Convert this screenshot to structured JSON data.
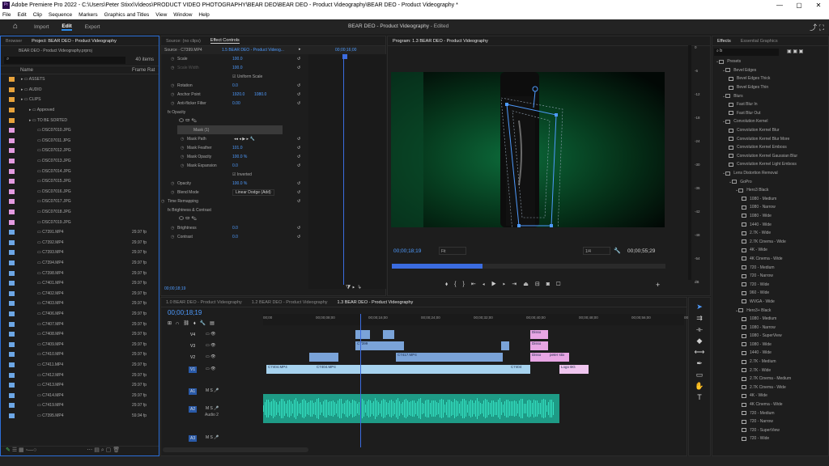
{
  "window": {
    "app_icon": "Pr",
    "title": "Adobe Premiere Pro 2022 - C:\\Users\\Peter Stixx\\Videos\\PRODUCT VIDEO PHOTOGRAPHY\\BEAR DEO\\BEAR DEO - Product Videography\\BEAR DEO - Product Videography *",
    "minimize": "—",
    "maximize": "▢",
    "close": "✕"
  },
  "menu": [
    "File",
    "Edit",
    "Clip",
    "Sequence",
    "Markers",
    "Graphics and Titles",
    "View",
    "Window",
    "Help"
  ],
  "workspaces": {
    "items": [
      "Import",
      "Edit",
      "Export"
    ],
    "active": "Edit"
  },
  "doc_title": {
    "name": "BEAR DEO - Product Videography",
    "status": "Edited",
    "sep": " - "
  },
  "project": {
    "tabs": [
      "Browser",
      "Project: BEAR DEO - Product Videography"
    ],
    "file": "BEAR DEO - Product Videography.prproj",
    "count": "40 items",
    "col_name": "Name",
    "col_rate": "Frame Rat",
    "items": [
      {
        "name": "ASSETS",
        "color": "or",
        "indent": 0,
        "rate": ""
      },
      {
        "name": "AUDIO",
        "color": "or",
        "indent": 0,
        "rate": ""
      },
      {
        "name": "CLIPS",
        "color": "or",
        "indent": 0,
        "rate": ""
      },
      {
        "name": "Approved",
        "color": "or",
        "indent": 1,
        "rate": ""
      },
      {
        "name": "TO BE SORTED",
        "color": "or",
        "indent": 1,
        "rate": ""
      },
      {
        "name": "DSC07010.JPG",
        "color": "pk",
        "indent": 2,
        "rate": ""
      },
      {
        "name": "DSC07011.JPG",
        "color": "pk",
        "indent": 2,
        "rate": ""
      },
      {
        "name": "DSC07012.JPG",
        "color": "pk",
        "indent": 2,
        "rate": ""
      },
      {
        "name": "DSC07013.JPG",
        "color": "pk",
        "indent": 2,
        "rate": ""
      },
      {
        "name": "DSC07014.JPG",
        "color": "pk",
        "indent": 2,
        "rate": ""
      },
      {
        "name": "DSC07015.JPG",
        "color": "pk",
        "indent": 2,
        "rate": ""
      },
      {
        "name": "DSC07016.JPG",
        "color": "pk",
        "indent": 2,
        "rate": ""
      },
      {
        "name": "DSC07017.JPG",
        "color": "pk",
        "indent": 2,
        "rate": ""
      },
      {
        "name": "DSC07018.JPG",
        "color": "pk",
        "indent": 2,
        "rate": ""
      },
      {
        "name": "DSC07019.JPG",
        "color": "pk",
        "indent": 2,
        "rate": ""
      },
      {
        "name": "C7391.MP4",
        "color": "bl",
        "indent": 2,
        "rate": "29.97 fp"
      },
      {
        "name": "C7392.MP4",
        "color": "bl",
        "indent": 2,
        "rate": "29.97 fp"
      },
      {
        "name": "C7393.MP4",
        "color": "bl",
        "indent": 2,
        "rate": "29.97 fp"
      },
      {
        "name": "C7394.MP4",
        "color": "bl",
        "indent": 2,
        "rate": "29.97 fp"
      },
      {
        "name": "C7398.MP4",
        "color": "bl",
        "indent": 2,
        "rate": "29.97 fp"
      },
      {
        "name": "C7401.MP4",
        "color": "bl",
        "indent": 2,
        "rate": "29.97 fp"
      },
      {
        "name": "C7402.MP4",
        "color": "bl",
        "indent": 2,
        "rate": "29.97 fp"
      },
      {
        "name": "C7403.MP4",
        "color": "bl",
        "indent": 2,
        "rate": "29.97 fp"
      },
      {
        "name": "C7406.MP4",
        "color": "bl",
        "indent": 2,
        "rate": "29.97 fp"
      },
      {
        "name": "C7407.MP4",
        "color": "bl",
        "indent": 2,
        "rate": "29.97 fp"
      },
      {
        "name": "C7408.MP4",
        "color": "bl",
        "indent": 2,
        "rate": "29.97 fp"
      },
      {
        "name": "C7409.MP4",
        "color": "bl",
        "indent": 2,
        "rate": "29.97 fp"
      },
      {
        "name": "C7410.MP4",
        "color": "bl",
        "indent": 2,
        "rate": "29.97 fp"
      },
      {
        "name": "C7411.MP4",
        "color": "bl",
        "indent": 2,
        "rate": "29.97 fp"
      },
      {
        "name": "C7412.MP4",
        "color": "bl",
        "indent": 2,
        "rate": "29.97 fp"
      },
      {
        "name": "C7413.MP4",
        "color": "bl",
        "indent": 2,
        "rate": "29.97 fp"
      },
      {
        "name": "C7414.MP4",
        "color": "bl",
        "indent": 2,
        "rate": "29.97 fp"
      },
      {
        "name": "C7419.MP4",
        "color": "bl",
        "indent": 2,
        "rate": "29.97 fp"
      },
      {
        "name": "C7395.MP4",
        "color": "bl",
        "indent": 2,
        "rate": "59.94 fp"
      }
    ]
  },
  "effect_controls": {
    "tabs": [
      "Source: (no clips)",
      "Effect Controls"
    ],
    "source": "Source · C7399.MP4",
    "clip": "1.5 BEAR DEO - Product Videog...",
    "mini_tc": "00;00;16;00",
    "rows": [
      {
        "label": "Scale",
        "value": "100.0",
        "indent": 1
      },
      {
        "label": "Scale Width",
        "value": "100.0",
        "indent": 1,
        "dim": true
      },
      {
        "label": "",
        "value": "Uniform Scale",
        "indent": 1,
        "check": true
      },
      {
        "label": "Rotation",
        "value": "0.0",
        "indent": 1
      },
      {
        "label": "Anchor Point",
        "value": "1920.0",
        "value2": "1080.0",
        "indent": 1
      },
      {
        "label": "Anti-flicker Filter",
        "value": "0.00",
        "indent": 1
      },
      {
        "label": "fx  Opacity",
        "value": "",
        "indent": 0
      },
      {
        "label": "",
        "value": "",
        "indent": 1,
        "shapes": true
      },
      {
        "label": "Mask (1)",
        "value": "",
        "indent": 1,
        "hl": true
      },
      {
        "label": "Mask Path",
        "value": "",
        "indent": 2,
        "play": true
      },
      {
        "label": "Mask Feather",
        "value": "101.0",
        "indent": 2
      },
      {
        "label": "Mask Opacity",
        "value": "100.0 %",
        "indent": 2
      },
      {
        "label": "Mask Expansion",
        "value": "0.0",
        "indent": 2
      },
      {
        "label": "",
        "value": "Inverted",
        "indent": 2,
        "check": true
      },
      {
        "label": "Opacity",
        "value": "100.0 %",
        "indent": 1
      },
      {
        "label": "Blend Mode",
        "value": "Linear Dodge (Add)",
        "indent": 1
      },
      {
        "label": "Time Remapping",
        "value": "",
        "indent": 0
      },
      {
        "label": "fx  Brightness & Contrast",
        "value": "",
        "indent": 0
      },
      {
        "label": "",
        "value": "",
        "indent": 1,
        "shapes": true
      },
      {
        "label": "Brightness",
        "value": "0.0",
        "indent": 1
      },
      {
        "label": "Contrast",
        "value": "0.0",
        "indent": 1
      }
    ],
    "timecode": "00;00;18;19"
  },
  "program": {
    "title": "Program: 1.3 BEAR DEO - Product Videography",
    "timecode": "00;00;18;19",
    "fit": "Fit",
    "quality": "1/4",
    "duration": "00;00;55;29",
    "playhead_fraction": 0.33
  },
  "effects_panel": {
    "tabs": [
      "Effects",
      "Essential Graphics"
    ],
    "search": "b",
    "tree": [
      {
        "t": "Presets",
        "l": 0,
        "f": 1
      },
      {
        "t": "Bevel Edges",
        "l": 1,
        "f": 1
      },
      {
        "t": "Bevel Edges Thick",
        "l": 2
      },
      {
        "t": "Bevel Edges Thin",
        "l": 2
      },
      {
        "t": "Blurs",
        "l": 1,
        "f": 1
      },
      {
        "t": "Fast Blur In",
        "l": 2
      },
      {
        "t": "Fast Blur Out",
        "l": 2
      },
      {
        "t": "Convolution Kernel",
        "l": 1,
        "f": 1
      },
      {
        "t": "Convolution Kernel Blur",
        "l": 2
      },
      {
        "t": "Convolution Kernel Blur More",
        "l": 2
      },
      {
        "t": "Convolution Kernel Emboss",
        "l": 2
      },
      {
        "t": "Convolution Kernel Gaussian Blur",
        "l": 2
      },
      {
        "t": "Convolution Kernel Light Emboss",
        "l": 2
      },
      {
        "t": "Lens Distortion Removal",
        "l": 1,
        "f": 1
      },
      {
        "t": "GoPro",
        "l": 2,
        "f": 1
      },
      {
        "t": "Hero3 Black",
        "l": 3,
        "f": 1
      },
      {
        "t": "1080 - Medium",
        "l": 4
      },
      {
        "t": "1080 - Narrow",
        "l": 4
      },
      {
        "t": "1080 - Wide",
        "l": 4
      },
      {
        "t": "1440 - Wide",
        "l": 4
      },
      {
        "t": "2.7K - Wide",
        "l": 4
      },
      {
        "t": "2.7K Cinema - Wide",
        "l": 4
      },
      {
        "t": "4K - Wide",
        "l": 4
      },
      {
        "t": "4K Cinema - Wide",
        "l": 4
      },
      {
        "t": "720 - Medium",
        "l": 4
      },
      {
        "t": "720 - Narrow",
        "l": 4
      },
      {
        "t": "720 - Wide",
        "l": 4
      },
      {
        "t": "960 - Wide",
        "l": 4
      },
      {
        "t": "WVGA - Wide",
        "l": 4
      },
      {
        "t": "Hero3+ Black",
        "l": 3,
        "f": 1
      },
      {
        "t": "1080 - Medium",
        "l": 4
      },
      {
        "t": "1080 - Narrow",
        "l": 4
      },
      {
        "t": "1080 - SuperView",
        "l": 4
      },
      {
        "t": "1080 - Wide",
        "l": 4
      },
      {
        "t": "1440 - Wide",
        "l": 4
      },
      {
        "t": "2.7K - Medium",
        "l": 4
      },
      {
        "t": "2.7K - Wide",
        "l": 4
      },
      {
        "t": "2.7K Cinema - Medium",
        "l": 4
      },
      {
        "t": "2.7K Cinema - Wide",
        "l": 4
      },
      {
        "t": "4K - Wide",
        "l": 4
      },
      {
        "t": "4K Cinema - Wide",
        "l": 4
      },
      {
        "t": "720 - Medium",
        "l": 4
      },
      {
        "t": "720 - Narrow",
        "l": 4
      },
      {
        "t": "720 - SuperView",
        "l": 4
      },
      {
        "t": "720 - Wide",
        "l": 4
      }
    ]
  },
  "timeline": {
    "tabs": [
      "1.0 BEAR DEO - Product Videography",
      "1.2 BEAR DEO - Product Videography",
      "1.3 BEAR DEO - Product Videography"
    ],
    "timecode": "00;00;18;19",
    "ruler": [
      "00;00",
      "00;00;08;00",
      "00;00;16;00",
      "00;00;24;00",
      "00;00;32;00",
      "00;00;40;00",
      "00;00;48;00",
      "00;00;56;00",
      "00;01;04;02"
    ],
    "tracks": [
      "V4",
      "V3",
      "V2",
      "V1",
      "A1",
      "A2",
      "A3"
    ],
    "audio_label": "Audio 2",
    "clip_labels": {
      "c7399": "C7399",
      "c7417": "C7417.MP4",
      "c7404a": "C7404.MP4",
      "c7404b": "C7404.MP4",
      "c7404c": "C7404",
      "logo": "Logo BG",
      "peter": "peter stix",
      "d1": "Disso",
      "d2": "Disso",
      "d3": "Disso"
    }
  },
  "meter_labels": [
    "0",
    "-6",
    "-12",
    "-18",
    "-24",
    "-30",
    "-36",
    "-42",
    "-48",
    "-54",
    "dB"
  ]
}
